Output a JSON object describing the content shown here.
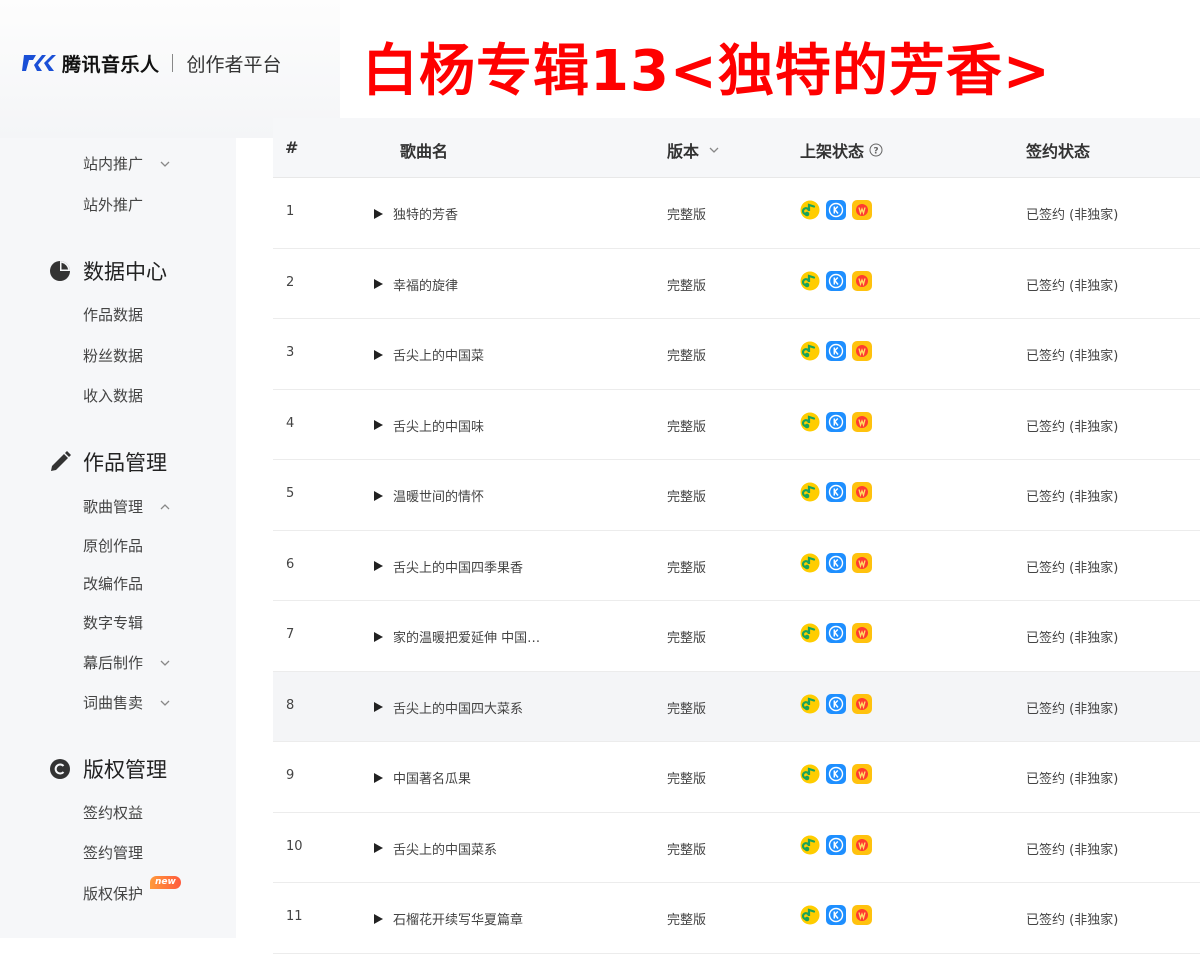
{
  "header": {
    "brand_name": "腾讯音乐人",
    "brand_sub": "创作者平台",
    "page_title": "白杨专辑13<独特的芳香>"
  },
  "sidebar": {
    "promo_items": [
      {
        "label": "站内推广",
        "chevron": "down"
      },
      {
        "label": "站外推广"
      }
    ],
    "data_center": {
      "title": "数据中心",
      "icon": "pie-chart-icon",
      "items": [
        "作品数据",
        "粉丝数据",
        "收入数据"
      ]
    },
    "works": {
      "title": "作品管理",
      "icon": "pencil-icon",
      "song_mgmt": {
        "label": "歌曲管理",
        "chevron": "up"
      },
      "sub_items": [
        "原创作品",
        "改编作品",
        "数字专辑"
      ],
      "post_production": {
        "label": "幕后制作",
        "chevron": "down"
      },
      "lyrics_sale": {
        "label": "词曲售卖",
        "chevron": "down"
      }
    },
    "copyright": {
      "title": "版权管理",
      "icon": "copyright-icon",
      "items": [
        "签约权益",
        "签约管理",
        "版权保护"
      ],
      "new_badge": "new"
    }
  },
  "table": {
    "headers": {
      "num": "#",
      "song": "歌曲名",
      "version": "版本",
      "status": "上架状态",
      "sign": "签约状态"
    },
    "rows": [
      {
        "num": "1",
        "song": "独特的芳香",
        "version": "完整版",
        "sign": "已签约 (非独家)"
      },
      {
        "num": "2",
        "song": "幸福的旋律",
        "version": "完整版",
        "sign": "已签约 (非独家)"
      },
      {
        "num": "3",
        "song": "舌尖上的中国菜",
        "version": "完整版",
        "sign": "已签约 (非独家)"
      },
      {
        "num": "4",
        "song": "舌尖上的中国味",
        "version": "完整版",
        "sign": "已签约 (非独家)"
      },
      {
        "num": "5",
        "song": "温暖世间的情怀",
        "version": "完整版",
        "sign": "已签约 (非独家)"
      },
      {
        "num": "6",
        "song": "舌尖上的中国四季果香",
        "version": "完整版",
        "sign": "已签约 (非独家)"
      },
      {
        "num": "7",
        "song": "家的温暖把爱延伸 中国…",
        "version": "完整版",
        "sign": "已签约 (非独家)"
      },
      {
        "num": "8",
        "song": "舌尖上的中国四大菜系",
        "version": "完整版",
        "sign": "已签约 (非独家)"
      },
      {
        "num": "9",
        "song": "中国著名瓜果",
        "version": "完整版",
        "sign": "已签约 (非独家)"
      },
      {
        "num": "10",
        "song": "舌尖上的中国菜系",
        "version": "完整版",
        "sign": "已签约 (非独家)"
      },
      {
        "num": "11",
        "song": "石榴花开续写华夏篇章",
        "version": "完整版",
        "sign": "已签约 (非独家)"
      }
    ],
    "platform_icons": [
      "qq-music-icon",
      "kugou-icon",
      "kuwo-icon"
    ],
    "colors": {
      "qq": "#ffcd00",
      "kugou": "#1e8fff",
      "kuwo": "#ffc20e",
      "title": "#ff0000"
    }
  }
}
